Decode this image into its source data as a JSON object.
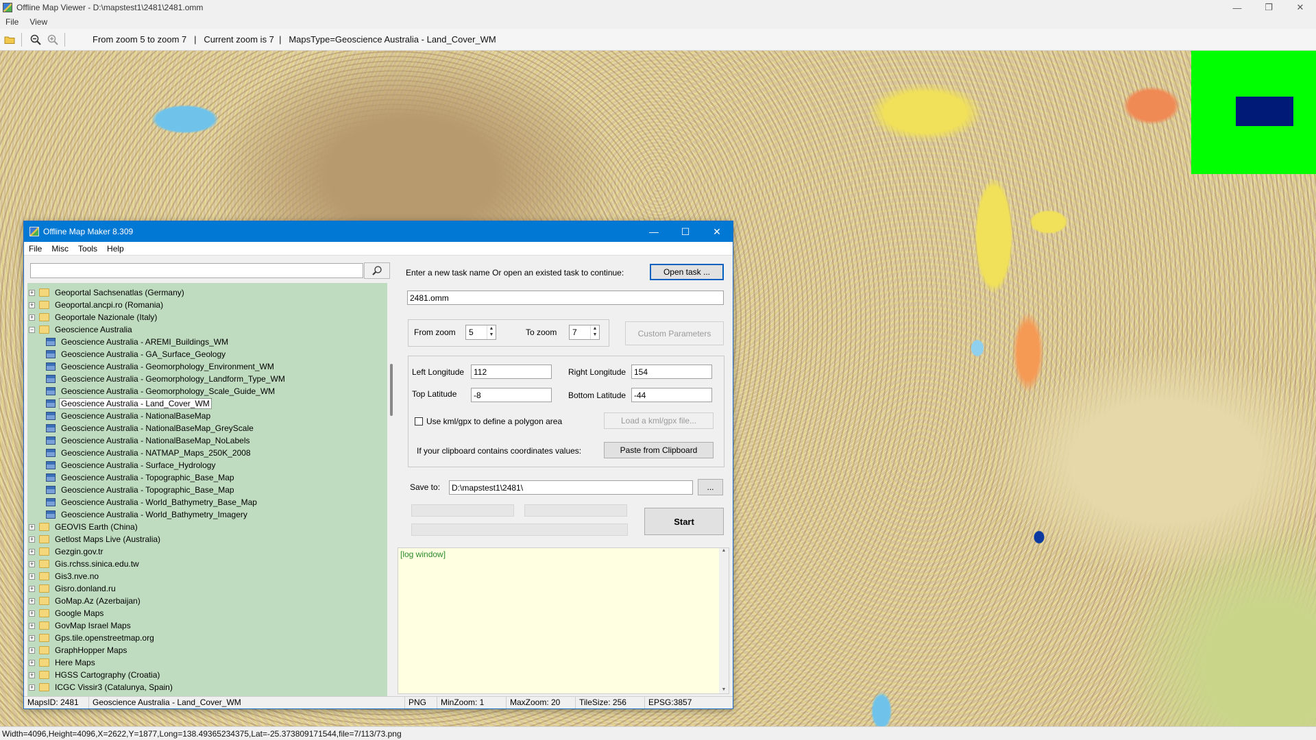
{
  "viewer": {
    "title": "Offline Map Viewer - D:\\mapstest1\\2481\\2481.omm",
    "menu": [
      "File",
      "View"
    ],
    "toolbar_info": "From zoom 5 to zoom 7   |   Current zoom is 7  |   MapsType=Geoscience Australia - Land_Cover_WM",
    "status": "Width=4096,Height=4096,X=2622,Y=1877,Long=138.49365234375,Lat=-25.373809171544,file=7/113/73.png",
    "minimap_color": "#00ff00",
    "minimap_view_color": "#001a78"
  },
  "maker": {
    "title": "Offline Map Maker 8.309",
    "menu": [
      "File",
      "Misc",
      "Tools",
      "Help"
    ],
    "search": {
      "value": ""
    },
    "tree": [
      {
        "label": "Geoportal Sachsenatlas (Germany)",
        "type": "folder",
        "expanded": false
      },
      {
        "label": "Geoportal.ancpi.ro (Romania)",
        "type": "folder",
        "expanded": false
      },
      {
        "label": "Geoportale Nazionale (Italy)",
        "type": "folder",
        "expanded": false
      },
      {
        "label": "Geoscience Australia",
        "type": "folder",
        "expanded": true
      },
      {
        "label": "Geoscience Australia - AREMI_Buildings_WM",
        "type": "map"
      },
      {
        "label": "Geoscience Australia - GA_Surface_Geology",
        "type": "map"
      },
      {
        "label": "Geoscience Australia - Geomorphology_Environment_WM",
        "type": "map"
      },
      {
        "label": "Geoscience Australia - Geomorphology_Landform_Type_WM",
        "type": "map"
      },
      {
        "label": "Geoscience Australia - Geomorphology_Scale_Guide_WM",
        "type": "map"
      },
      {
        "label": "Geoscience Australia - Land_Cover_WM",
        "type": "map",
        "selected": true
      },
      {
        "label": "Geoscience Australia - NationalBaseMap",
        "type": "map"
      },
      {
        "label": "Geoscience Australia - NationalBaseMap_GreyScale",
        "type": "map"
      },
      {
        "label": "Geoscience Australia - NationalBaseMap_NoLabels",
        "type": "map"
      },
      {
        "label": "Geoscience Australia - NATMAP_Maps_250K_2008",
        "type": "map"
      },
      {
        "label": "Geoscience Australia - Surface_Hydrology",
        "type": "map"
      },
      {
        "label": "Geoscience Australia - Topographic_Base_Map",
        "type": "map"
      },
      {
        "label": "Geoscience Australia - Topographic_Base_Map",
        "type": "map"
      },
      {
        "label": "Geoscience Australia - World_Bathymetry_Base_Map",
        "type": "map"
      },
      {
        "label": "Geoscience Australia - World_Bathymetry_Imagery",
        "type": "map"
      },
      {
        "label": "GEOVIS Earth (China)",
        "type": "folder",
        "expanded": false
      },
      {
        "label": "Getlost Maps Live (Australia)",
        "type": "folder",
        "expanded": false
      },
      {
        "label": "Gezgin.gov.tr",
        "type": "folder",
        "expanded": false
      },
      {
        "label": "Gis.rchss.sinica.edu.tw",
        "type": "folder",
        "expanded": false
      },
      {
        "label": "Gis3.nve.no",
        "type": "folder",
        "expanded": false
      },
      {
        "label": "Gisro.donland.ru",
        "type": "folder",
        "expanded": false
      },
      {
        "label": "GoMap.Az (Azerbaijan)",
        "type": "folder",
        "expanded": false
      },
      {
        "label": "Google Maps",
        "type": "folder",
        "expanded": false
      },
      {
        "label": "GovMap Israel Maps",
        "type": "folder",
        "expanded": false
      },
      {
        "label": "Gps.tile.openstreetmap.org",
        "type": "folder",
        "expanded": false
      },
      {
        "label": "GraphHopper Maps",
        "type": "folder",
        "expanded": false
      },
      {
        "label": "Here Maps",
        "type": "folder",
        "expanded": false
      },
      {
        "label": "HGSS Cartography (Croatia)",
        "type": "folder",
        "expanded": false
      },
      {
        "label": "ICGC Vissir3 (Catalunya, Spain)",
        "type": "folder",
        "expanded": false
      }
    ],
    "task_prompt": "Enter a new task name Or open an existed task to continue:",
    "open_task_label": "Open task ...",
    "task_name": "2481.omm",
    "from_zoom_label": "From zoom",
    "from_zoom": "5",
    "to_zoom_label": "To zoom",
    "to_zoom": "7",
    "custom_params_label": "Custom Parameters",
    "left_lon_label": "Left Longitude",
    "left_lon": "112",
    "right_lon_label": "Right Longitude",
    "right_lon": "154",
    "top_lat_label": "Top Latitude",
    "top_lat": "-8",
    "bottom_lat_label": "Bottom Latitude",
    "bottom_lat": "-44",
    "kml_check_label": "Use kml/gpx to define a polygon area",
    "load_kml_label": "Load a kml/gpx file...",
    "clipboard_prompt": "If your clipboard contains coordinates values:",
    "paste_label": "Paste from Clipboard",
    "save_to_label": "Save to:",
    "save_to": "D:\\mapstest1\\2481\\",
    "browse_label": "...",
    "start_label": "Start",
    "log_text": "[log window]",
    "status": {
      "maps_id": "MapsID: 2481",
      "maps_name": "Geoscience Australia - Land_Cover_WM",
      "format": "PNG",
      "min_zoom": "MinZoom: 1",
      "max_zoom": "MaxZoom: 20",
      "tile_size": "TileSize: 256",
      "epsg": "EPSG:3857"
    }
  }
}
